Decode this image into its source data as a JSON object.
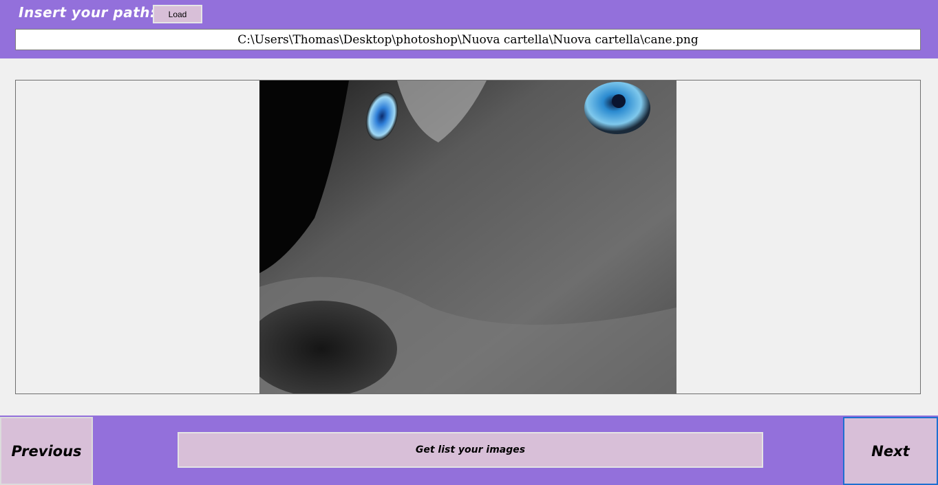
{
  "header": {
    "path_label": "Insert your path:",
    "load_label": "Load",
    "path_value": "C:\\Users\\Thomas\\Desktop\\photoshop\\Nuova cartella\\Nuova cartella\\cane.png"
  },
  "viewer": {
    "image_subject": "husky-dog-closeup-photo"
  },
  "footer": {
    "previous_label": "Previous",
    "list_label": "Get list your images",
    "next_label": "Next"
  },
  "colors": {
    "panel": "#9370db",
    "button": "#d8bfd8",
    "background": "#f0f0f0"
  }
}
